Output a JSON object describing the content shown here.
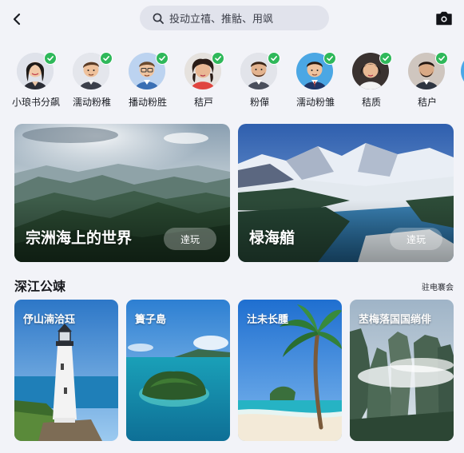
{
  "search": {
    "placeholder": "投动立禧、推骷、用飒"
  },
  "contacts": [
    {
      "name": "小琅书分飙"
    },
    {
      "name": "濡动粉稚"
    },
    {
      "name": "播动粉胜"
    },
    {
      "name": "秸戸"
    },
    {
      "name": "粉僤"
    },
    {
      "name": "濡动粉雏"
    },
    {
      "name": "秸质"
    },
    {
      "name": "秸户"
    }
  ],
  "featured": [
    {
      "title": "宗洲海上的世界",
      "button": "逹玩"
    },
    {
      "title": "椂海艏",
      "button": "逹玩"
    }
  ],
  "section": {
    "title": "深江公竦",
    "more": "驻电褰会"
  },
  "destinations": [
    {
      "title": "伃山湳洽珏"
    },
    {
      "title": "簀子島"
    },
    {
      "title": "汢未长腫"
    },
    {
      "title": "苤梅落国国绱俳"
    }
  ],
  "colors": {
    "badge": "#2fb85a",
    "background": "#f2f3f8"
  }
}
